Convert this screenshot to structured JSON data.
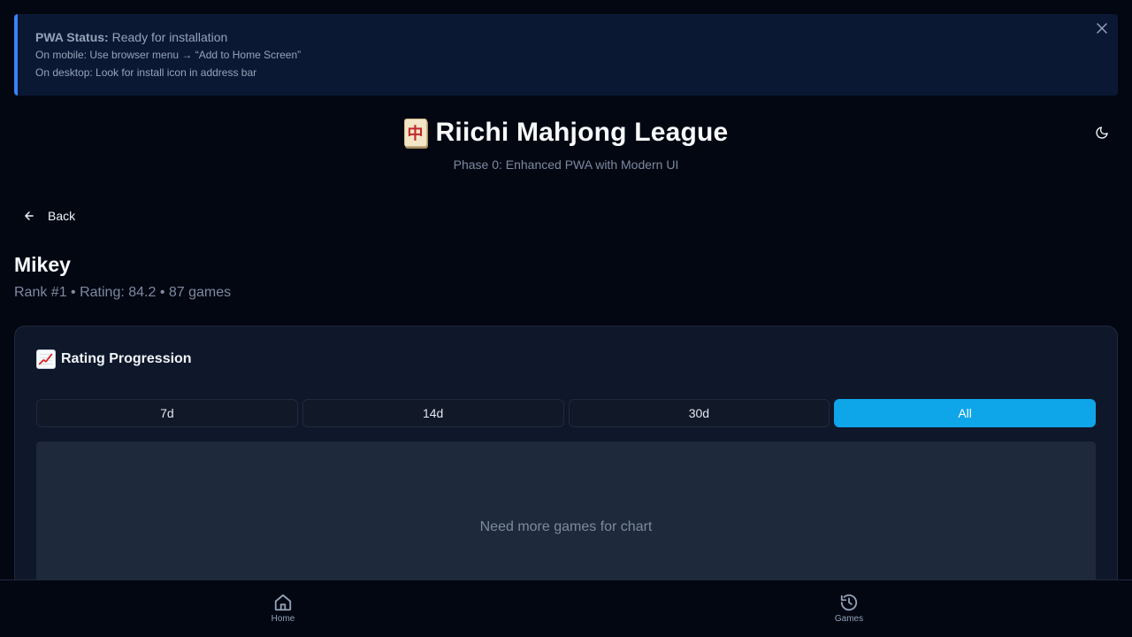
{
  "pwa_banner": {
    "status_label": "PWA Status:",
    "status_value": "Ready for installation",
    "mobile_hint": "On mobile: Use browser menu → “Add to Home Screen”",
    "desktop_hint": "On desktop: Look for install icon in address bar",
    "close_icon": "close-icon"
  },
  "header": {
    "logo_glyph": "中",
    "title": "Riichi Mahjong League",
    "subtitle": "Phase 0: Enhanced PWA with Modern UI",
    "theme_icon": "moon-icon"
  },
  "nav": {
    "back_label": "Back"
  },
  "player": {
    "name": "Mikey",
    "meta": "Rank #1 • Rating: 84.2 • 87 games"
  },
  "rating_card": {
    "title": "Rating Progression",
    "tabs": [
      {
        "label": "7d",
        "active": false
      },
      {
        "label": "14d",
        "active": false
      },
      {
        "label": "30d",
        "active": false
      },
      {
        "label": "All",
        "active": true
      }
    ],
    "empty_message": "Need more games for chart"
  },
  "bottom_nav": {
    "items": [
      {
        "label": "Home",
        "icon": "home-icon"
      },
      {
        "label": "Games",
        "icon": "history-icon"
      }
    ]
  },
  "colors": {
    "accent": "#0ea5e9",
    "banner_border": "#3b82f6",
    "background": "#030712"
  }
}
